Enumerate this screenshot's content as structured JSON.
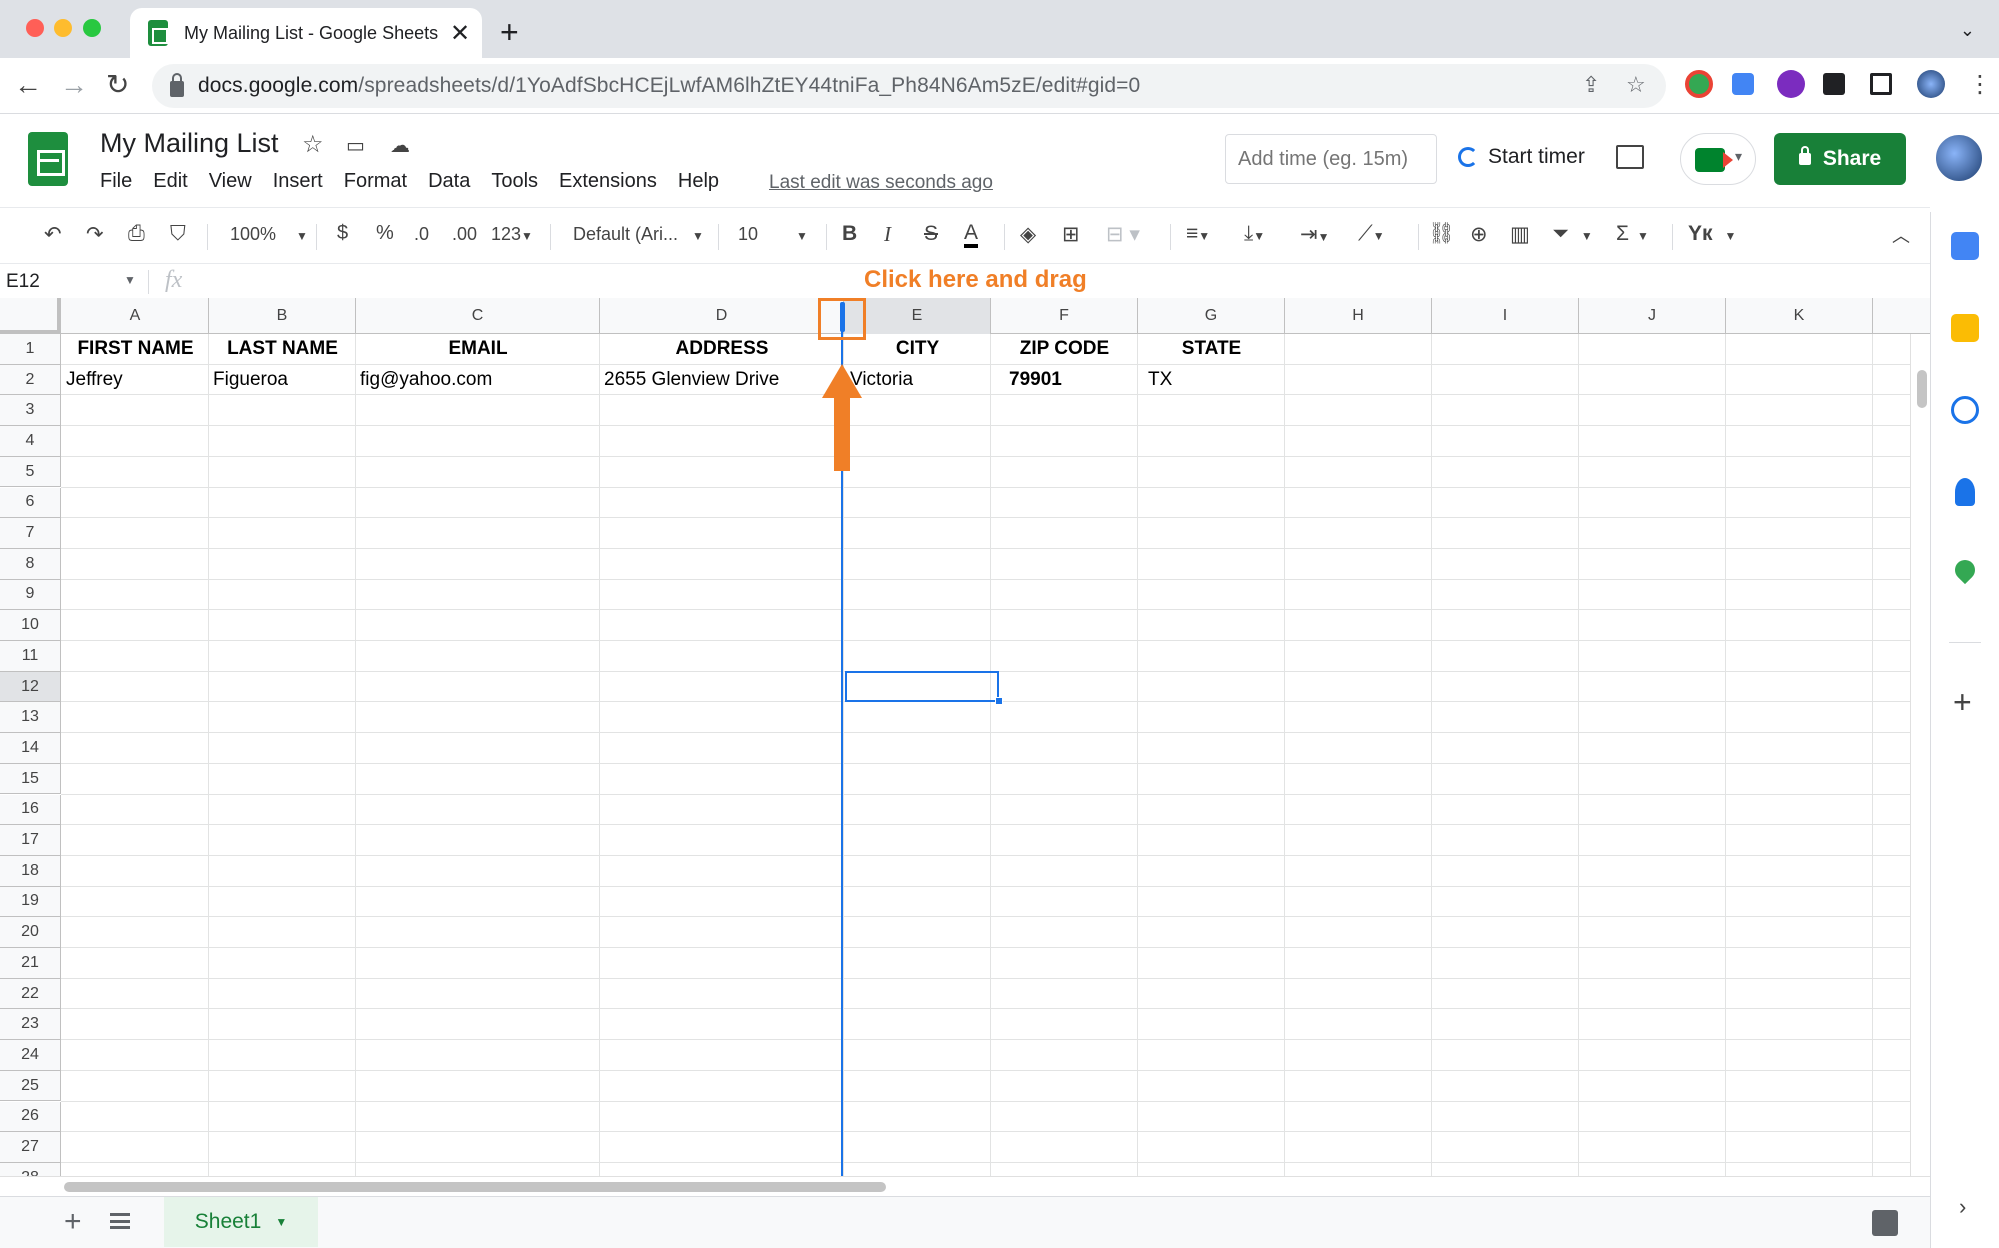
{
  "browser": {
    "tab_title": "My Mailing List - Google Sheets",
    "tab_close": "✕",
    "new_tab": "+",
    "url_host": "docs.google.com",
    "url_path": "/spreadsheets/d/1YoAdfSbcHCEjLwfAM6lhZtEY44tniFa_Ph84N6Am5zE/edit#gid=0"
  },
  "header": {
    "doc_title": "My Mailing List",
    "menu": [
      "File",
      "Edit",
      "View",
      "Insert",
      "Format",
      "Data",
      "Tools",
      "Extensions",
      "Help"
    ],
    "last_edit": "Last edit was seconds ago",
    "time_placeholder": "Add time (eg. 15m)",
    "start_timer": "Start timer",
    "share": "Share"
  },
  "toolbar": {
    "zoom": "100%",
    "currency": "$",
    "percent": "%",
    "dec_decrease": ".0",
    "dec_increase": ".00",
    "more_formats": "123",
    "font": "Default (Ari...",
    "font_size": "10",
    "bold": "B",
    "italic": "I",
    "strike": "S",
    "text_color": "A",
    "sum": "Σ"
  },
  "formula_bar": {
    "name_box": "E12",
    "fx": "fx"
  },
  "grid": {
    "columns": [
      "A",
      "B",
      "C",
      "D",
      "E",
      "F",
      "G",
      "H",
      "I",
      "J",
      "K"
    ],
    "selected_column": "E",
    "selected_row": 12,
    "row_count": 28,
    "header_row": [
      "FIRST NAME",
      "LAST NAME",
      "EMAIL",
      "ADDRESS",
      "CITY",
      "ZIP CODE",
      "STATE"
    ],
    "row2": [
      "Jeffrey",
      "Figueroa",
      "fig@yahoo.com",
      "2655  Glenview Drive",
      "Victoria",
      "79901",
      "TX"
    ]
  },
  "annotation": {
    "callout": "Click here and drag",
    "color": "#f07f27"
  },
  "sheets": {
    "active": "Sheet1"
  },
  "colors": {
    "accent": "#1a73e8",
    "share": "#188038"
  }
}
